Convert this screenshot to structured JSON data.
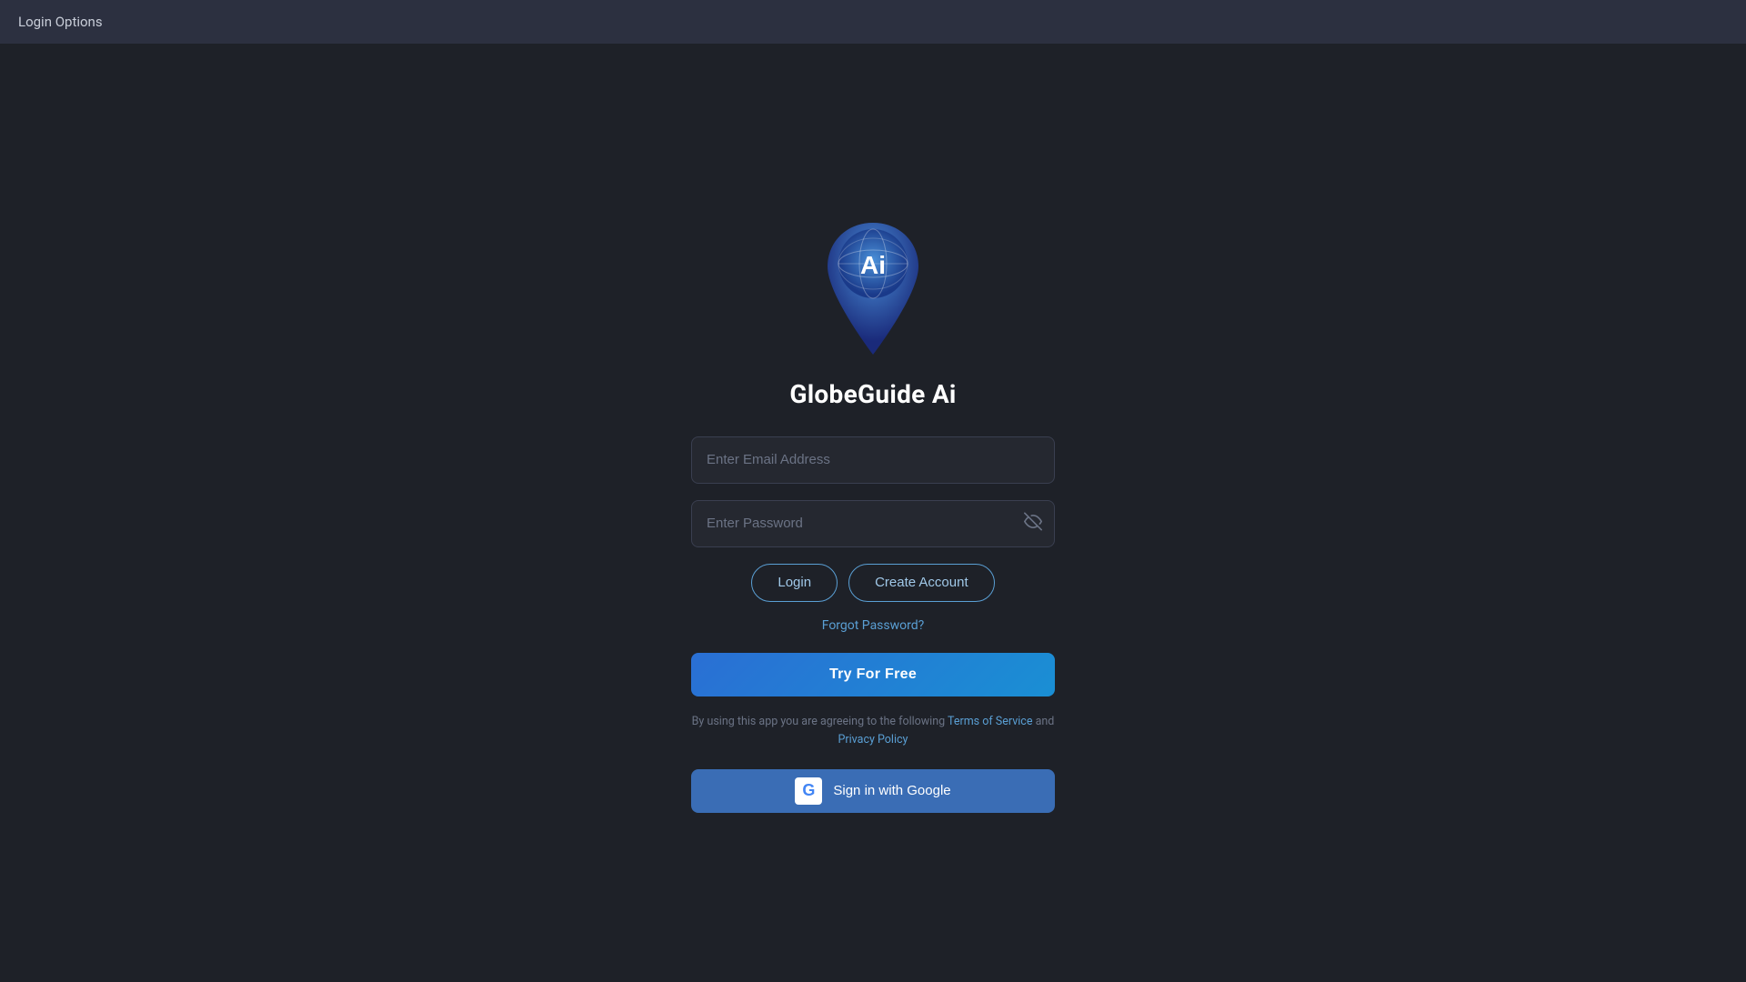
{
  "topbar": {
    "title": "Login Options"
  },
  "logo": {
    "alt": "GlobeGuide Ai Logo"
  },
  "app": {
    "title": "GlobeGuide Ai"
  },
  "form": {
    "email_placeholder": "Enter Email Address",
    "password_placeholder": "Enter Password",
    "login_button": "Login",
    "create_account_button": "Create Account",
    "forgot_password": "Forgot Password?",
    "try_free_button": "Try For Free",
    "terms_prefix": "By using this app you are agreeing to the following ",
    "terms_link": "Terms of Service",
    "terms_and": " and ",
    "privacy_link": "Privacy Policy",
    "google_button": "Sign in with Google",
    "google_icon": "G"
  }
}
